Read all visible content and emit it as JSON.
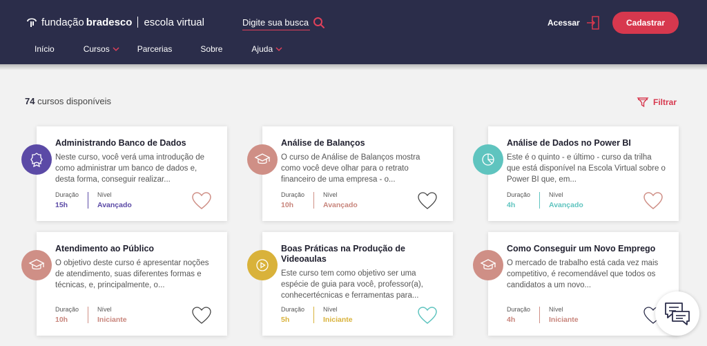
{
  "brand": {
    "part1": "fundação",
    "part2": "bradesco",
    "part3": "escola virtual"
  },
  "search": {
    "placeholder": "Digite sua busca"
  },
  "header": {
    "access_label": "Acessar",
    "register_label": "Cadastrar"
  },
  "nav": [
    {
      "label": "Início",
      "has_dropdown": false
    },
    {
      "label": "Cursos",
      "has_dropdown": true
    },
    {
      "label": "Parcerias",
      "has_dropdown": false
    },
    {
      "label": "Sobre",
      "has_dropdown": false
    },
    {
      "label": "Ajuda",
      "has_dropdown": true
    }
  ],
  "results": {
    "count": "74",
    "count_suffix": "cursos disponíveis",
    "filter_label": "Filtrar"
  },
  "meta_labels": {
    "duration": "Duração",
    "level": "Nível"
  },
  "courses": [
    {
      "title": "Administrando Banco de Dados",
      "description": "Neste curso, você verá uma introdução de como administrar um banco de dados e, desta forma, conseguir realizar...",
      "duration": "15h",
      "level": "Avançado",
      "color": "#5b4aa6",
      "icon": "badge-icon"
    },
    {
      "title": "Análise de Balanços",
      "description": "O curso de Análise de Balanços mostra como você deve olhar para o retrato financeiro de uma empresa - o...",
      "duration": "10h",
      "level": "Avançado",
      "color": "#cf8f86",
      "icon": "graduation-cap-icon"
    },
    {
      "title": "Análise de Dados no Power BI",
      "description": "Este é o quinto - e último - curso da trilha que está disponível na Escola Virtual sobre o Power BI que, em...",
      "duration": "4h",
      "level": "Avançado",
      "color": "#5fc4bf",
      "icon": "pie-chart-icon"
    },
    {
      "title": "Atendimento ao Público",
      "description": "O objetivo deste curso é apresentar noções de atendimento, suas diferentes formas e técnicas, e, principalmente, o...",
      "duration": "10h",
      "level": "Iniciante",
      "color": "#cf8f86",
      "icon": "graduation-cap-icon"
    },
    {
      "title": "Boas Práticas na Produção de Videoaulas",
      "description": "Este curso tem como objetivo ser uma espécie de guia para você, professor(a), conhecertécnicas e ferramentas para...",
      "duration": "5h",
      "level": "Iniciante",
      "color": "#d9b23a",
      "icon": "play-icon"
    },
    {
      "title": "Como Conseguir um Novo Emprego",
      "description": "O mercado de trabalho está cada vez mais competitivo, é recomendável que todos os candidatos a um novo...",
      "duration": "4h",
      "level": "Iniciante",
      "color": "#cf8f86",
      "icon": "graduation-cap-icon"
    }
  ],
  "colors": {
    "header_bg": "#2b2d4a",
    "accent": "#d7384e"
  }
}
